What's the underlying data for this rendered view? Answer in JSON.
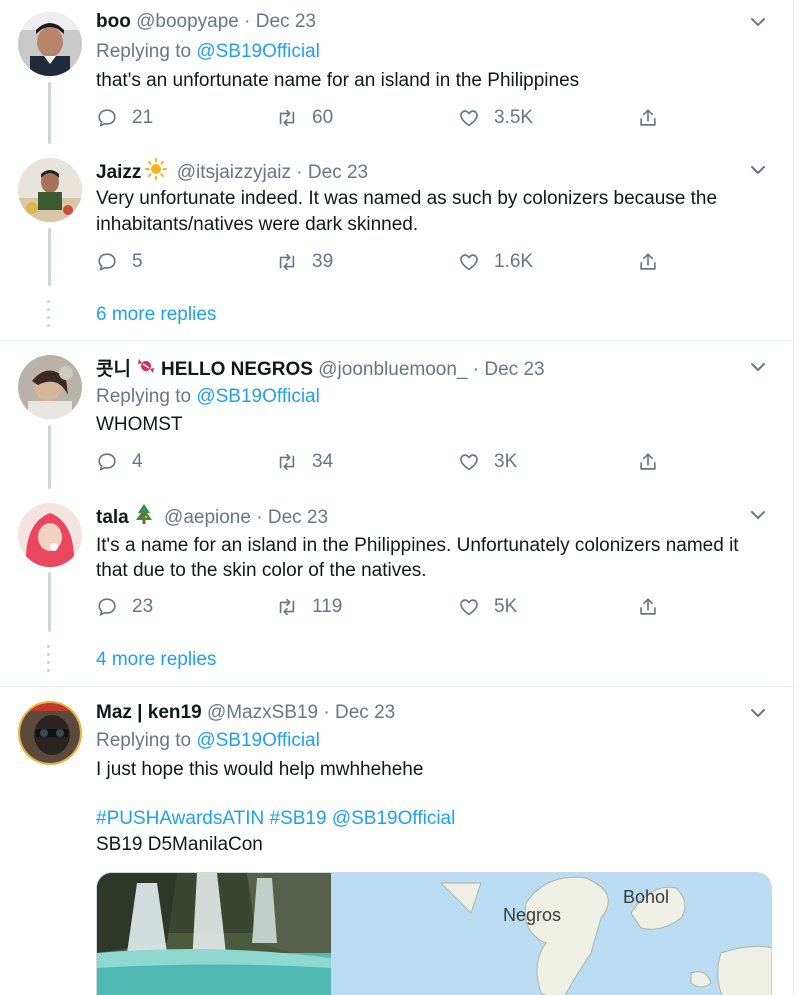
{
  "tweets": [
    {
      "name": "boo",
      "handle": "@boopyape",
      "date": "Dec 23",
      "replying_label": "Replying to",
      "replying_to": "@SB19Official",
      "text": "that's an unfortunate name for an island in the Philippines",
      "replies": "21",
      "retweets": "60",
      "likes": "3.5K"
    },
    {
      "name": "Jaizz",
      "emoji": "sun",
      "handle": "@itsjaizzyjaiz",
      "date": "Dec 23",
      "text_line1": "Very unfortunate indeed. It was named as such by colonizers because the",
      "text_line2": "inhabitants/natives were dark skinned.",
      "replies": "5",
      "retweets": "39",
      "likes": "1.6K",
      "more_replies": "6 more replies"
    },
    {
      "name_prefix": "콧니",
      "name_suffix": "HELLO NEGROS",
      "emoji": "candy",
      "handle": "@joonbluemoon_",
      "date": "Dec 23",
      "replying_label": "Replying to",
      "replying_to": "@SB19Official",
      "text": "WHOMST",
      "replies": "4",
      "retweets": "34",
      "likes": "3K"
    },
    {
      "name": "tala",
      "emoji": "christmas-tree",
      "handle": "@aepione",
      "date": "Dec 23",
      "text_line1": "It's a name for an island in the Philippines. Unfortunately colonizers named it",
      "text_line2": "that due to the skin color of the natives.",
      "replies": "23",
      "retweets": "119",
      "likes": "5K",
      "more_replies": "4 more replies"
    },
    {
      "name": "Maz | ken19",
      "handle": "@MazxSB19",
      "date": "Dec 23",
      "replying_label": "Replying to",
      "replying_to": "@SB19Official",
      "text": "I just hope this would help mwhhehehe",
      "hashtags": "#PUSHAwardsATIN #SB19 @SB19Official",
      "text_line3": "SB19 D5ManilaCon",
      "map_label_negros": "Negros",
      "map_label_bohol": "Bohol"
    }
  ],
  "icons": {
    "reply": "reply-icon",
    "retweet": "retweet-icon",
    "like": "like-icon",
    "share": "share-icon",
    "caret": "chevron-down-icon"
  },
  "colors": {
    "link": "#1da1f2",
    "muted": "#657786",
    "text": "#14171a",
    "thread_line": "#ccd6dd"
  }
}
